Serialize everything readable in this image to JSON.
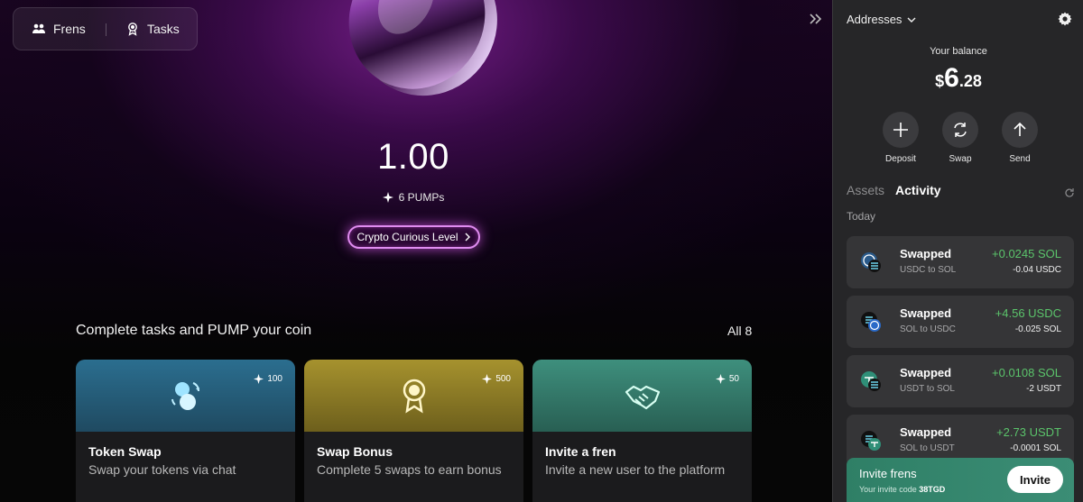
{
  "nav": {
    "frens_label": "Frens",
    "tasks_label": "Tasks"
  },
  "hero": {
    "score": "1.00",
    "pumps": "6 PUMPs",
    "level_label": "Crypto Curious Level"
  },
  "tasks_section": {
    "title": "Complete tasks and PUMP your coin",
    "all_label": "All 8",
    "cards": [
      {
        "points": "100",
        "title": "Token Swap",
        "desc": "Swap your tokens via chat",
        "icon": "coins-swap-icon"
      },
      {
        "points": "500",
        "title": "Swap Bonus",
        "desc": "Complete 5 swaps to earn bonus",
        "icon": "medal-icon"
      },
      {
        "points": "50",
        "title": "Invite a fren",
        "desc": "Invite a new user to the platform",
        "icon": "handshake-icon"
      }
    ]
  },
  "wallet": {
    "addresses_label": "Addresses",
    "balance_label": "Your balance",
    "balance_currency": "$",
    "balance_whole": "6",
    "balance_fraction": ".28",
    "actions": {
      "deposit": "Deposit",
      "swap": "Swap",
      "send": "Send"
    },
    "tabs": {
      "assets": "Assets",
      "activity": "Activity"
    },
    "day_label": "Today",
    "transactions": [
      {
        "type": "Swapped",
        "pair": "USDC to SOL",
        "received": "+0.0245 SOL",
        "sent": "-0.04 USDC"
      },
      {
        "type": "Swapped",
        "pair": "SOL to USDC",
        "received": "+4.56 USDC",
        "sent": "-0.025 SOL"
      },
      {
        "type": "Swapped",
        "pair": "USDT to SOL",
        "received": "+0.0108 SOL",
        "sent": "-2 USDT"
      },
      {
        "type": "Swapped",
        "pair": "SOL to USDT",
        "received": "+2.73 USDT",
        "sent": "-0.0001 SOL"
      }
    ],
    "invite": {
      "title": "Invite frens",
      "code_label": "Your invite code",
      "code": "38TGD",
      "button": "Invite"
    }
  },
  "colors": {
    "accent_pink": "#e08cf0",
    "positive_green": "#5bc46b",
    "panel_bg": "#262628"
  }
}
